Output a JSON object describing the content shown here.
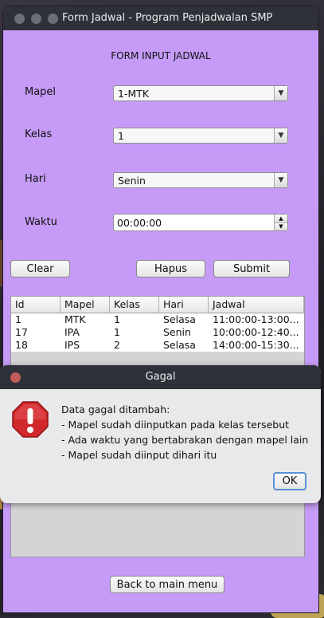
{
  "window": {
    "title": "Form Jadwal - Program Penjadwalan SMP"
  },
  "form": {
    "heading": "FORM INPUT JADWAL",
    "mapel": {
      "label": "Mapel",
      "value": "1-MTK"
    },
    "kelas": {
      "label": "Kelas",
      "value": "1"
    },
    "hari": {
      "label": "Hari",
      "value": "Senin"
    },
    "waktu": {
      "label": "Waktu",
      "value": "00:00:00"
    }
  },
  "buttons": {
    "clear": "Clear",
    "hapus": "Hapus",
    "submit": "Submit",
    "back": "Back to main menu"
  },
  "table": {
    "columns": [
      "Id",
      "Mapel",
      "Kelas",
      "Hari",
      "Jadwal"
    ],
    "rows": [
      [
        "1",
        "MTK",
        "1",
        "Selasa",
        "11:00:00-13:00..."
      ],
      [
        "17",
        "IPA",
        "1",
        "Senin",
        "10:00:00-12:40..."
      ],
      [
        "18",
        "IPS",
        "2",
        "Selasa",
        "14:00:00-15:30..."
      ]
    ]
  },
  "dialog": {
    "title": "Gagal",
    "lines": [
      "Data gagal ditambah:",
      "- Mapel sudah diinputkan pada kelas tersebut",
      "- Ada waktu yang bertabrakan dengan mapel lain",
      "- Mapel sudah diinput dihari itu"
    ],
    "ok": "OK",
    "icon": "error-stop-icon"
  },
  "colors": {
    "window_bg": "#c59bf7",
    "titlebar": "#2f3138",
    "error_red": "#d0282b"
  }
}
